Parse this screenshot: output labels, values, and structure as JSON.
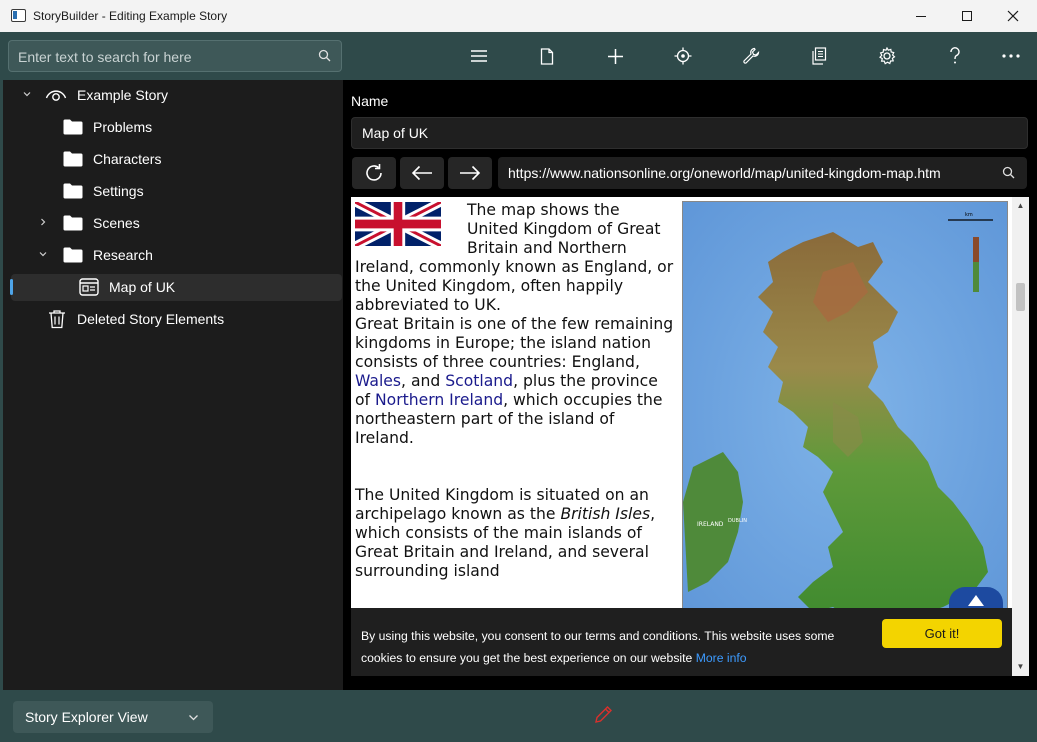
{
  "window": {
    "title": "StoryBuilder - Editing Example Story"
  },
  "toolbar": {
    "search_placeholder": "Enter text to search for here",
    "icons": [
      "menu-icon",
      "new-file-icon",
      "add-icon",
      "target-icon",
      "wrench-icon",
      "copy-icon",
      "gear-icon",
      "help-icon",
      "more-icon"
    ]
  },
  "tree": {
    "root": "Example Story",
    "items": [
      {
        "label": "Problems"
      },
      {
        "label": "Characters"
      },
      {
        "label": "Settings"
      },
      {
        "label": "Scenes"
      },
      {
        "label": "Research"
      },
      {
        "label": "Map of UK"
      }
    ],
    "trash": "Deleted Story Elements"
  },
  "detail": {
    "name_label": "Name",
    "name_value": "Map of UK",
    "url": "https://www.nationsonline.org/oneworld/map/united-kingdom-map.htm"
  },
  "web": {
    "p1_a": "The map shows the United Kingdom of Great Britain and Northern Ireland, commonly known as England, or the United Kingdom, often happily abbreviated to UK.",
    "p1_b": "Great Britain is one of the few remaining kingdoms in Europe; the island nation consists of three countries: England,",
    "link_wales": "Wales",
    "p1_c": ", and",
    "link_scotland": "Scotland",
    "p1_d": ", plus the province of",
    "link_ni": "Northern Ireland",
    "p1_e": ", which occupies the northeastern part of the island of Ireland.",
    "p2_a": "The United Kingdom is situated on an archipelago known as the",
    "p2_em": "British Isles",
    "p2_b": ", which consists of the main islands of Great Britain and Ireland, and several surrounding island",
    "map_label_ireland": "IRELAND",
    "map_label_dublin": "DUBLIN",
    "map_scale_label": "km",
    "cookie_text": "By using this website, you consent to our terms and conditions. This website uses some cookies to ensure you get the best experience on our website",
    "cookie_link": "More info",
    "cookie_button": "Got it!"
  },
  "bottom": {
    "view_select": "Story Explorer View"
  },
  "colors": {
    "toolbar": "#2f4a4a",
    "accent": "#4ea4e8",
    "cookie_button": "#f3d400"
  }
}
